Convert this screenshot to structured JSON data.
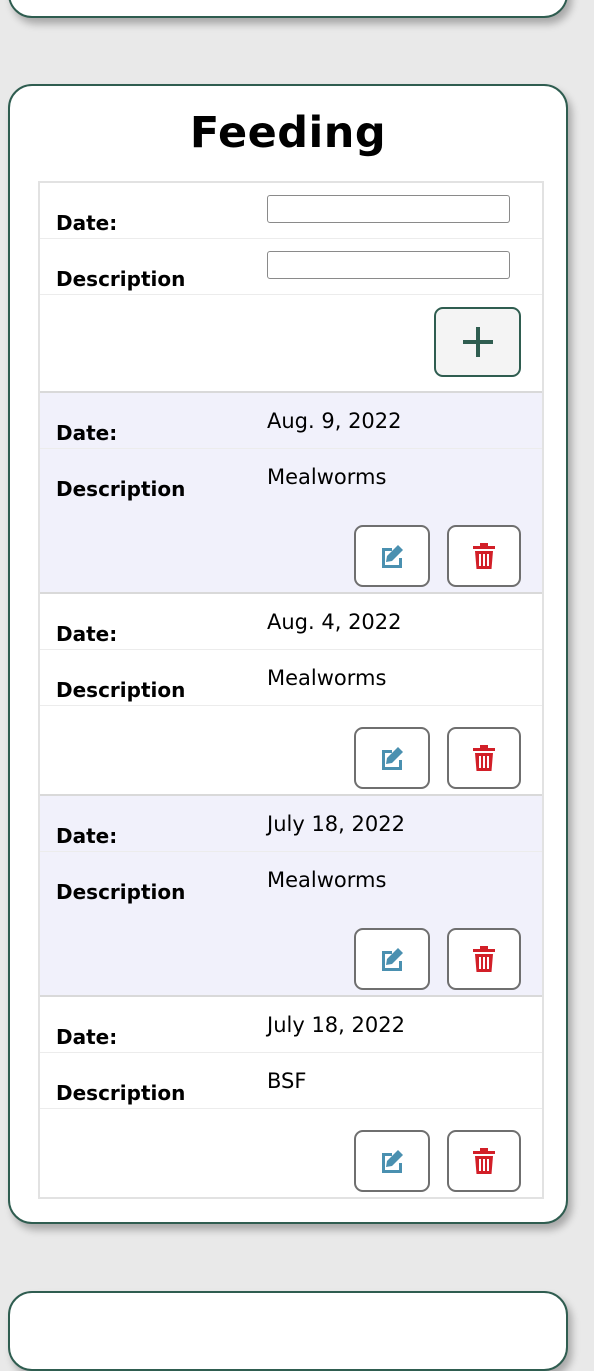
{
  "section": {
    "title": "Feeding"
  },
  "new_entry": {
    "date_label": "Date:",
    "description_label": "Description",
    "date_value": "",
    "description_value": "",
    "add_icon": "plus-icon"
  },
  "entries": [
    {
      "date_label": "Date:",
      "date": "Aug. 9, 2022",
      "description_label": "Description",
      "description": "Mealworms"
    },
    {
      "date_label": "Date:",
      "date": "Aug. 4, 2022",
      "description_label": "Description",
      "description": "Mealworms"
    },
    {
      "date_label": "Date:",
      "date": "July 18, 2022",
      "description_label": "Description",
      "description": "Mealworms"
    },
    {
      "date_label": "Date:",
      "date": "July 18, 2022",
      "description_label": "Description",
      "description": "BSF"
    }
  ],
  "colors": {
    "card_border": "#2f5d50",
    "edit_icon": "#4a90b0",
    "delete_icon": "#d21f28",
    "alt_row": "#f1f1fb"
  },
  "icons": {
    "edit": "edit-icon",
    "delete": "trash-icon"
  }
}
